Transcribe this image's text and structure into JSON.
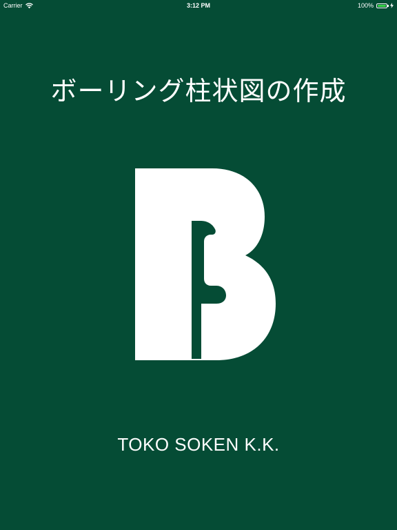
{
  "status_bar": {
    "carrier": "Carrier",
    "time": "3:12 PM",
    "battery_percent": "100%",
    "battery_level": 1.0,
    "battery_color": "#3ad34a",
    "icons": [
      "wifi-icon",
      "battery-icon",
      "charging-icon"
    ]
  },
  "splash": {
    "title": "ボーリング柱状図の作成",
    "logo_icon": "b-logo-icon",
    "company": "TOKO SOKEN K.K.",
    "background_color": "#054c35",
    "text_color": "#ffffff"
  }
}
